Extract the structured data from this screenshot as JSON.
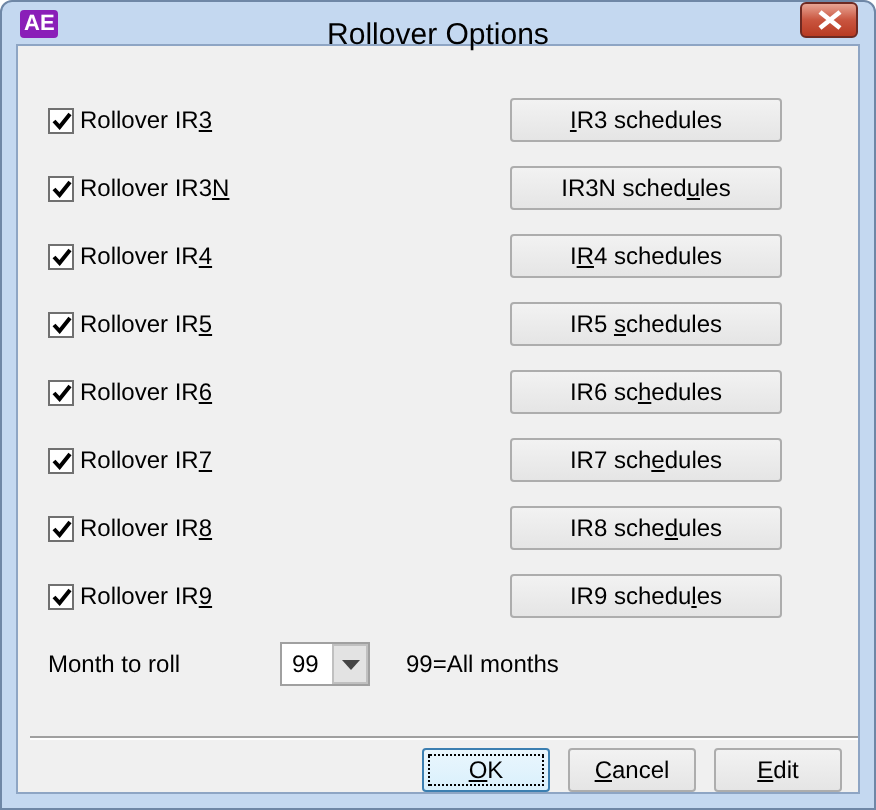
{
  "window": {
    "title": "Rollover Options",
    "app_icon": "AE"
  },
  "rows": [
    {
      "checkbox": {
        "label": {
          "before": "Rollover IR",
          "key": "3"
        },
        "checked": true
      },
      "button": {
        "key": "I",
        "after": "R3 schedules"
      }
    },
    {
      "checkbox": {
        "label": {
          "before": "Rollover IR3",
          "key": "N"
        },
        "checked": true
      },
      "button": {
        "before": "IR3N sched",
        "key": "u",
        "after": "les"
      }
    },
    {
      "checkbox": {
        "label": {
          "before": "Rollover IR",
          "key": "4"
        },
        "checked": true
      },
      "button": {
        "before": "I",
        "key": "R",
        "after": "4 schedules"
      }
    },
    {
      "checkbox": {
        "label": {
          "before": "Rollover IR",
          "key": "5"
        },
        "checked": true
      },
      "button": {
        "before": "IR5 ",
        "key": "s",
        "after": "chedules"
      }
    },
    {
      "checkbox": {
        "label": {
          "before": "Rollover IR",
          "key": "6"
        },
        "checked": true
      },
      "button": {
        "before": "IR6 sc",
        "key": "h",
        "after": "edules"
      }
    },
    {
      "checkbox": {
        "label": {
          "before": "Rollover IR",
          "key": "7"
        },
        "checked": true
      },
      "button": {
        "before": "IR7 sch",
        "key": "e",
        "after": "dules"
      }
    },
    {
      "checkbox": {
        "label": {
          "before": "Rollover IR",
          "key": "8"
        },
        "checked": true
      },
      "button": {
        "before": "IR8 sche",
        "key": "d",
        "after": "ules"
      }
    },
    {
      "checkbox": {
        "label": {
          "before": "Rollover IR",
          "key": "9"
        },
        "checked": true
      },
      "button": {
        "before": "IR9 schedu",
        "key": "l",
        "after": "es"
      }
    }
  ],
  "month": {
    "label": "Month to roll",
    "value": "99",
    "hint": "99=All months"
  },
  "buttons": [
    {
      "label": {
        "key": "O",
        "after": "K"
      },
      "default": true
    },
    {
      "label": {
        "key": "C",
        "after": "ancel"
      },
      "default": false
    },
    {
      "label": {
        "key": "E",
        "after": "dit"
      },
      "default": false
    }
  ]
}
